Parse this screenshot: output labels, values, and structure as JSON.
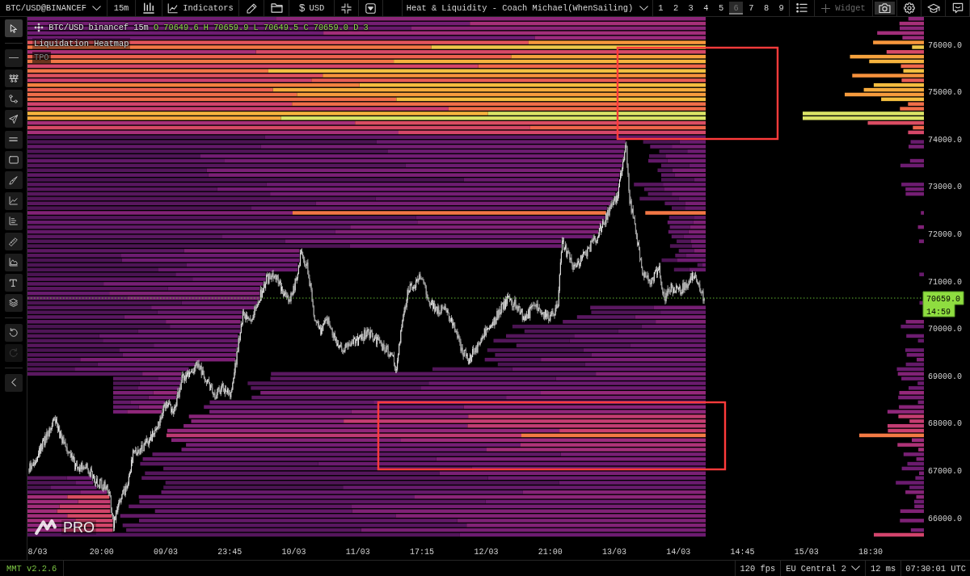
{
  "toolbar": {
    "symbol": "BTC/USD@BINANCEF",
    "interval": "15m",
    "indicators_button": "Indicators",
    "currency": {
      "symbol": "$",
      "code": "USD"
    },
    "layout": "Heat & Liquidity - Coach Michael(WhenSailing)",
    "layout_slots": [
      {
        "label": "1",
        "selected": false
      },
      {
        "label": "2",
        "selected": false
      },
      {
        "label": "3",
        "selected": false
      },
      {
        "label": "4",
        "selected": false
      },
      {
        "label": "5",
        "selected": false
      },
      {
        "label": "6",
        "selected": true
      },
      {
        "label": "7",
        "selected": false
      },
      {
        "label": "8",
        "selected": false
      },
      {
        "label": "9",
        "selected": false
      }
    ],
    "widget": {
      "label": "Widget",
      "disabled": true
    },
    "actions": [
      {
        "kind": "camera",
        "active": true
      },
      {
        "kind": "settings",
        "active": false
      },
      {
        "kind": "learn",
        "active": false
      },
      {
        "kind": "feedback",
        "active": false
      }
    ]
  },
  "tool_groups": [
    {
      "tools": [
        {
          "kind": "cursor",
          "selected": true,
          "disabled": false
        }
      ]
    },
    {
      "tools": [
        {
          "kind": "line",
          "selected": false,
          "disabled": false
        },
        {
          "kind": "nodes",
          "selected": false,
          "disabled": false
        },
        {
          "kind": "path",
          "selected": false,
          "disabled": false
        },
        {
          "kind": "send",
          "selected": false,
          "disabled": false
        },
        {
          "kind": "parallel",
          "selected": false,
          "disabled": false
        },
        {
          "kind": "rectangle",
          "selected": false,
          "disabled": false
        },
        {
          "kind": "brush",
          "selected": false,
          "disabled": false
        },
        {
          "kind": "chart",
          "selected": false,
          "disabled": false
        },
        {
          "kind": "bars",
          "selected": false,
          "disabled": false
        },
        {
          "kind": "ruler",
          "selected": false,
          "disabled": false
        },
        {
          "kind": "area",
          "selected": false,
          "disabled": false
        },
        {
          "kind": "text",
          "selected": false,
          "disabled": false
        },
        {
          "kind": "layers",
          "selected": false,
          "disabled": false
        }
      ]
    },
    {
      "tools": [
        {
          "kind": "undo",
          "selected": false,
          "disabled": false
        },
        {
          "kind": "redo",
          "selected": false,
          "disabled": true
        }
      ]
    },
    {
      "tools": [
        {
          "kind": "collapse",
          "selected": false,
          "disabled": false
        }
      ]
    }
  ],
  "chart": {
    "legend": {
      "symbol": "BTC/USD binancef 15m",
      "values": [
        "O 70649.6",
        "H 70659.9",
        "L 70649.5",
        "C 70659.0",
        "D 3"
      ]
    },
    "indicators": [
      {
        "name": "Liquidation Heatmap",
        "hidden": false
      },
      {
        "name": "TPO",
        "hidden": true
      }
    ],
    "price_axis": {
      "labels": [
        "76000.0",
        "75000.0",
        "74000.0",
        "73000.0",
        "72000.0",
        "71000.0",
        "70000.0",
        "69000.0",
        "68000.0",
        "67000.0",
        "66000.0"
      ]
    },
    "time_axis": {
      "labels": [
        "8/03",
        "20:00",
        "09/03",
        "23:45",
        "10/03",
        "11/03",
        "17:15",
        "12/03",
        "21:00",
        "13/03",
        "14/03",
        "14:45",
        "15/03",
        "18:30"
      ]
    },
    "last_price": {
      "price": "70659.0",
      "countdown": "14:59"
    },
    "logo": "PRO"
  },
  "status_bar": {
    "version": "MMT v2.2.6",
    "fps": "120 fps",
    "region": "EU Central 2",
    "latency": "12 ms",
    "clock": "07:30:01 UTC"
  }
}
